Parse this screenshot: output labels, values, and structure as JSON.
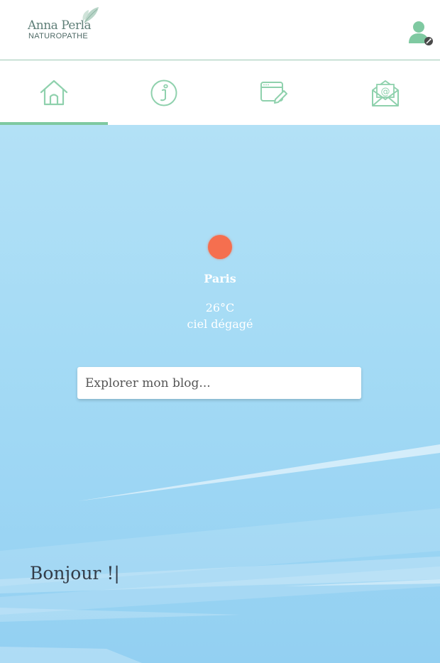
{
  "header": {
    "logo_name": "Anna Perla",
    "logo_subtitle": "NATUROPATHE",
    "user_icon": "user-account-icon"
  },
  "nav": {
    "tabs": [
      {
        "icon": "home-icon",
        "active": true
      },
      {
        "icon": "info-icon",
        "active": false
      },
      {
        "icon": "blog-edit-icon",
        "active": false
      },
      {
        "icon": "mail-icon",
        "active": false
      }
    ]
  },
  "weather": {
    "city": "Paris",
    "temperature": "26°C",
    "description": "ciel dégagé",
    "icon": "sun-icon"
  },
  "search": {
    "placeholder": "Explorer mon blog..."
  },
  "greeting": {
    "text": "Bonjour !",
    "cursor": "|"
  },
  "colors": {
    "accent": "#7fc9a1",
    "sun": "#f56f4f",
    "sky": "#a5dbf5"
  }
}
